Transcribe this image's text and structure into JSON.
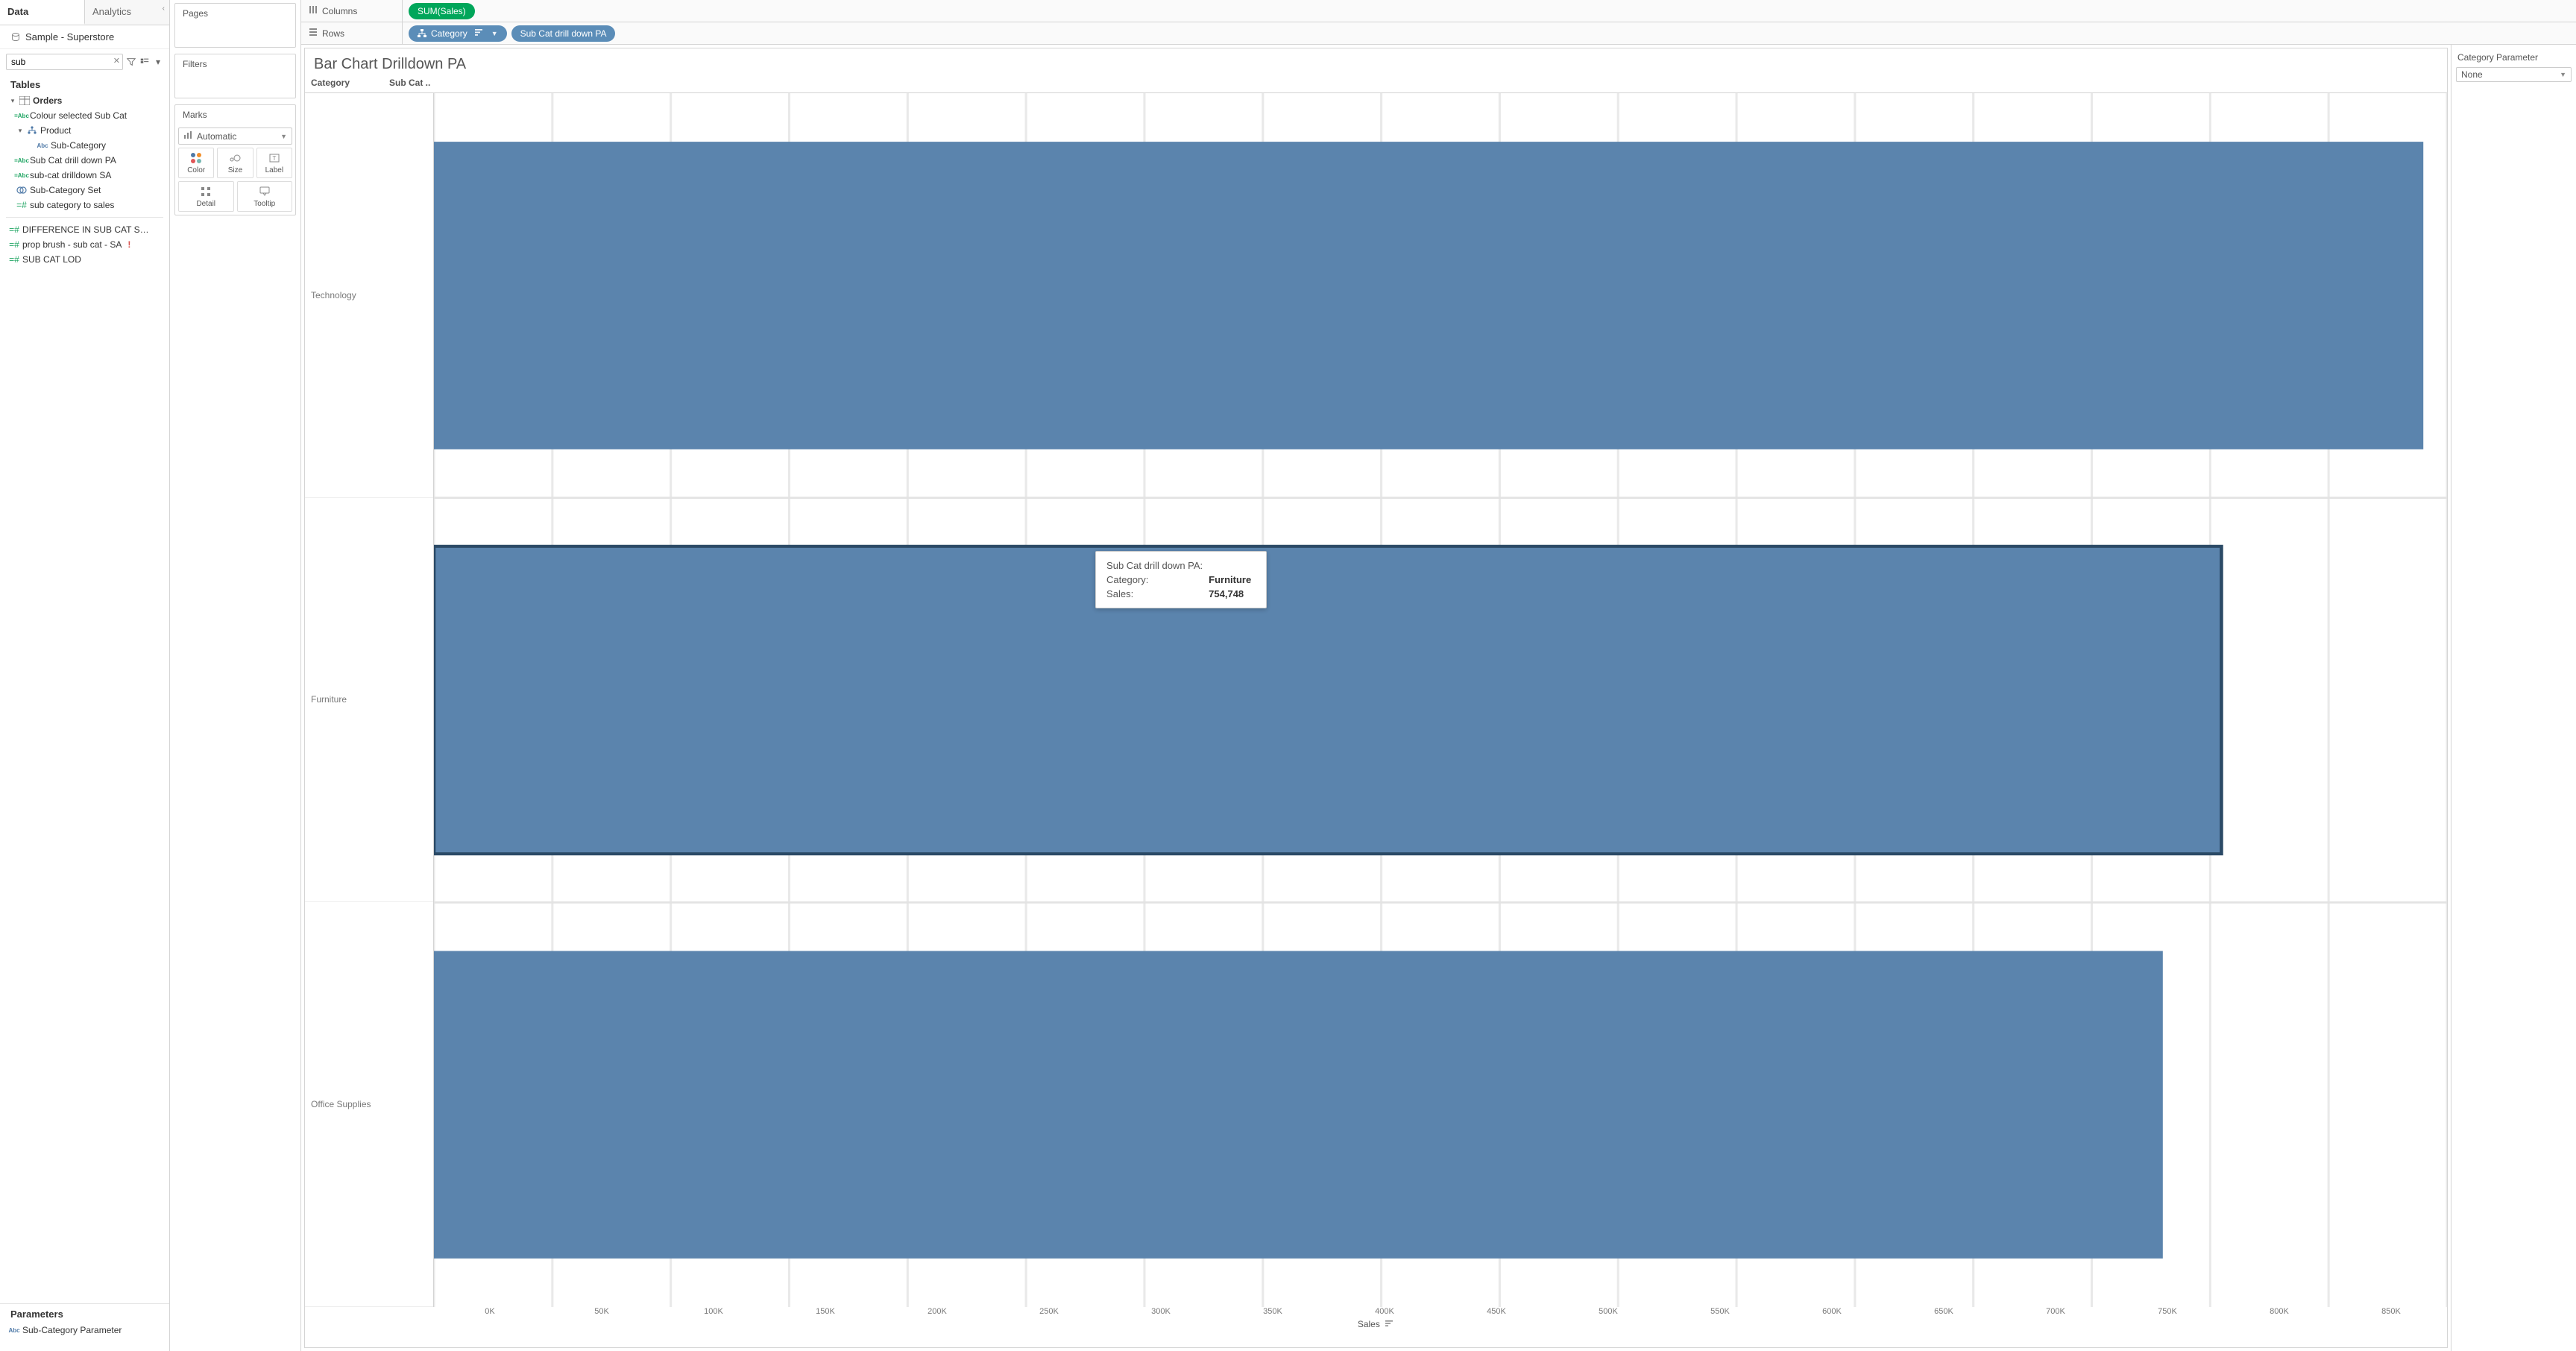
{
  "sidebar": {
    "tabs": {
      "data": "Data",
      "analytics": "Analytics"
    },
    "datasource": "Sample - Superstore",
    "search": {
      "value": "sub"
    },
    "tables_header": "Tables",
    "orders": {
      "label": "Orders"
    },
    "fields": {
      "colour_selected_sub_cat": "Colour selected Sub Cat",
      "product": "Product",
      "sub_category": "Sub-Category",
      "sub_cat_drill_down_pa": "Sub Cat drill down PA",
      "sub_cat_drilldown_sa": "sub-cat drilldown SA",
      "sub_category_set": "Sub-Category Set",
      "sub_category_to_sales": "sub category to sales",
      "diff_sub_cat_s": "DIFFERENCE IN SUB CAT S…",
      "prop_brush": "prop brush - sub cat - SA",
      "sub_cat_lod": "SUB CAT LOD"
    },
    "parameters_header": "Parameters",
    "parameters": {
      "sub_category_parameter": "Sub-Category Parameter"
    }
  },
  "cards": {
    "pages": "Pages",
    "filters": "Filters",
    "marks": "Marks",
    "mark_type": "Automatic",
    "cells": {
      "color": "Color",
      "size": "Size",
      "label": "Label",
      "detail": "Detail",
      "tooltip": "Tooltip"
    }
  },
  "shelves": {
    "columns_label": "Columns",
    "rows_label": "Rows",
    "columns": {
      "sum_sales": "SUM(Sales)"
    },
    "rows": {
      "category": "Category",
      "sub_cat_pa": "Sub Cat drill down PA"
    }
  },
  "viz": {
    "title": "Bar Chart Drilldown PA",
    "row_header_1": "Category",
    "row_header_2": "Sub Cat ..",
    "axis_label": "Sales",
    "ticks": [
      "0K",
      "50K",
      "100K",
      "150K",
      "200K",
      "250K",
      "300K",
      "350K",
      "400K",
      "450K",
      "500K",
      "550K",
      "600K",
      "650K",
      "700K",
      "750K",
      "800K",
      "850K"
    ]
  },
  "tooltip": {
    "line1_label": "Sub Cat drill down PA:",
    "line2_label": "Category:",
    "line2_value": "Furniture",
    "line3_label": "Sales:",
    "line3_value": "754,748"
  },
  "right": {
    "title": "Category Parameter",
    "value": "None"
  },
  "chart_data": {
    "type": "bar",
    "orientation": "horizontal",
    "title": "Bar Chart Drilldown PA",
    "xlabel": "Sales",
    "ylabel_primary": "Category",
    "ylabel_secondary": "Sub Cat drill down PA",
    "xlim": [
      0,
      850000
    ],
    "xticks": [
      0,
      50000,
      100000,
      150000,
      200000,
      250000,
      300000,
      350000,
      400000,
      450000,
      500000,
      550000,
      600000,
      650000,
      700000,
      750000,
      800000,
      850000
    ],
    "categories": [
      "Technology",
      "Furniture",
      "Office Supplies"
    ],
    "values": [
      840000,
      754748,
      730000
    ],
    "selected_index": 1,
    "bar_color": "#5b84ad"
  }
}
